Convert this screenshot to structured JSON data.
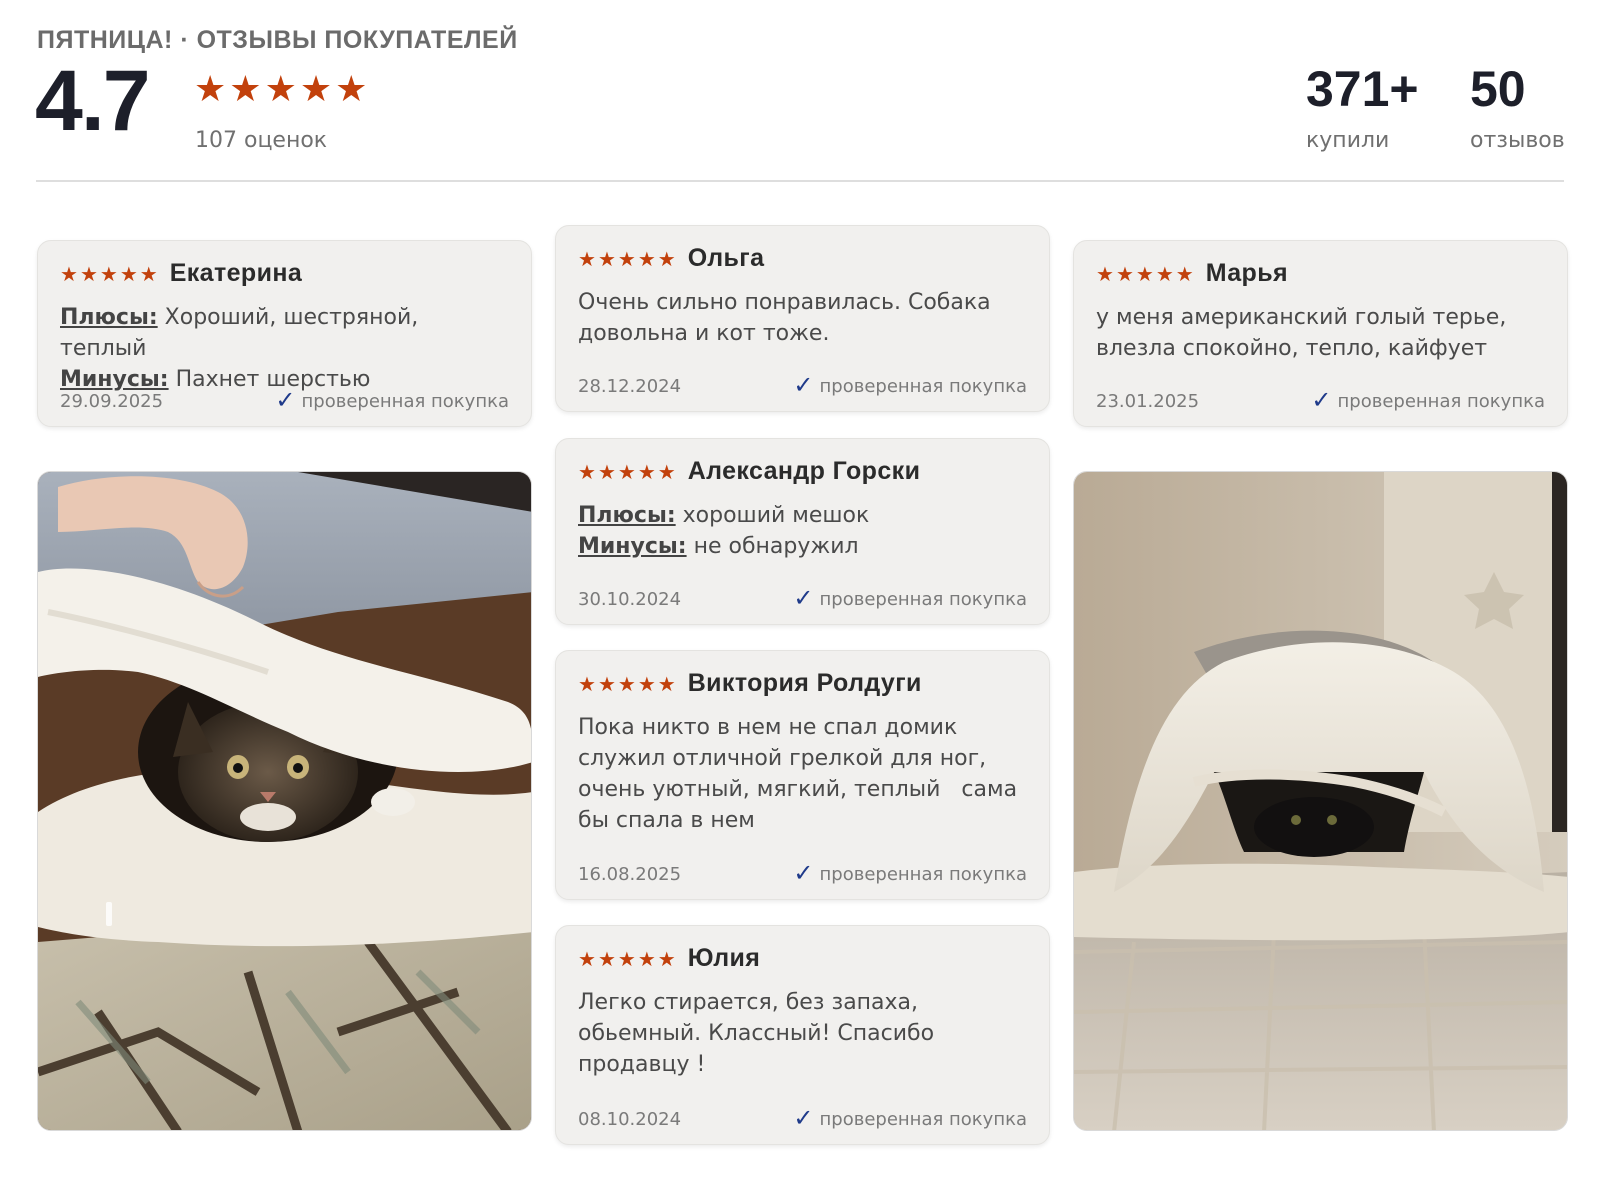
{
  "header": {
    "brand_line": "ПЯТНИЦА! · ОТЗЫВЫ ПОКУПАТЕЛЕЙ",
    "average_rating": "4.7",
    "stars": 5,
    "ratings_count": "107 оценок",
    "stats": [
      {
        "value": "371+",
        "label": "купили"
      },
      {
        "value": "50",
        "label": "отзывов"
      }
    ]
  },
  "reviews": [
    {
      "name": "Екатерина",
      "stars": 5,
      "pros_label": "Плюсы:",
      "pros": "Хороший, шестряной, теплый",
      "cons_label": "Минусы:",
      "cons": "Пахнет шерстью",
      "date": "29.09.2025",
      "verified": "проверенная покупка"
    },
    {
      "name": "Ольга",
      "stars": 5,
      "text": "Очень сильно понравилась. Собака довольна и кот тоже.",
      "date": "28.12.2024",
      "verified": "проверенная покупка"
    },
    {
      "name": "Марья",
      "stars": 5,
      "text": "у меня американский голый терье, влезла спокойно, тепло, кайфует",
      "date": "23.01.2025",
      "verified": "проверенная покупка"
    },
    {
      "name": "Александр Горски",
      "stars": 5,
      "pros_label": "Плюсы:",
      "pros": "хороший мешок",
      "cons_label": "Минусы:",
      "cons": "не обнаружил",
      "date": "30.10.2024",
      "verified": "проверенная покупка"
    },
    {
      "name": "Виктория Ролдуги",
      "stars": 5,
      "text": "Пока никто в нем не спал домик служил отличной грелкой для ног, очень уютный, мягкий, теплый   сама бы спала в нем",
      "date": "16.08.2025",
      "verified": "проверенная покупка"
    },
    {
      "name": "Юлия",
      "stars": 5,
      "text": "Легко стирается, без запаха, обьемный. Классный! Спасибо продавцу !",
      "date": "08.10.2024",
      "verified": "проверенная покупка"
    }
  ],
  "colors": {
    "star": "#c2410c",
    "check": "#1f3a8a",
    "card_bg": "#f1f0ee"
  }
}
